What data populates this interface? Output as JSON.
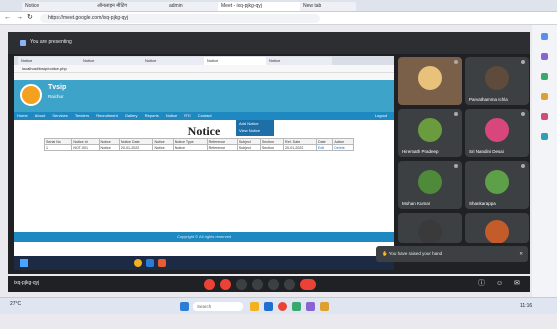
{
  "outer_browser": {
    "tabs": [
      "Notice",
      "ऑनलाइन मीटिंग",
      "admin",
      "Meet - ixq-pjkg-qyj",
      "New tab"
    ],
    "url": "https://meet.google.com/ixq-pjkg-qyj"
  },
  "meet": {
    "present_banner": "You are presenting",
    "notification": "You have raised your hand",
    "meeting_code": "ixq-pjkg-qyj",
    "participants": [
      {
        "name": "",
        "color": "#e8c17a"
      },
      {
        "name": "Parvathamma Ichla",
        "color": "#5e4b3c"
      },
      {
        "name": "Hiremath Pradeep",
        "color": "#6a9c3f"
      },
      {
        "name": "Sri Nandini Desai",
        "color": "#d8467a"
      },
      {
        "name": "Mohan Kumar",
        "color": "#4f8a3a"
      },
      {
        "name": "Shankarappa",
        "color": "#5da049"
      },
      {
        "name": "",
        "color": "#3a3a3a"
      },
      {
        "name": "",
        "color": "#c45b2a"
      }
    ]
  },
  "shared_screen": {
    "tabs": [
      "Notice",
      "Notice",
      "Notice",
      "Notice",
      "Notice"
    ],
    "url": "localhost/tvsip/notice.php",
    "site_title": "Tvsip",
    "site_subtitle": "Raichur",
    "nav": [
      "Home",
      "About",
      "Services",
      "Tenders",
      "Recruitment",
      "Gallery",
      "Reports",
      "Notice",
      "RTI",
      "Contact",
      "Logout"
    ],
    "dropdown": [
      "Add Notice",
      "View Notice"
    ],
    "page_title": "Notice",
    "table": {
      "headers": [
        "Serial No",
        "Notice Id",
        "Notice",
        "Notice Date",
        "Notice",
        "Notice Type",
        "Reference",
        "Subject",
        "Section",
        "Ref. Date",
        "Date",
        "Action"
      ],
      "rows": [
        [
          "1",
          "NOT-001",
          "Notice",
          "20-01-2022",
          "Notice",
          "Notice",
          "Reference",
          "Subject",
          "Section",
          "20-01-2022",
          "Edit",
          "Delete"
        ]
      ]
    },
    "footer": "Copyright © All rights reserved"
  },
  "windows": {
    "search_placeholder": "Search",
    "time": "11:16",
    "weather": "27°C"
  },
  "colors": {
    "accent": "#1e88c0",
    "header": "#3ea3c9",
    "danger": "#ea4335"
  }
}
